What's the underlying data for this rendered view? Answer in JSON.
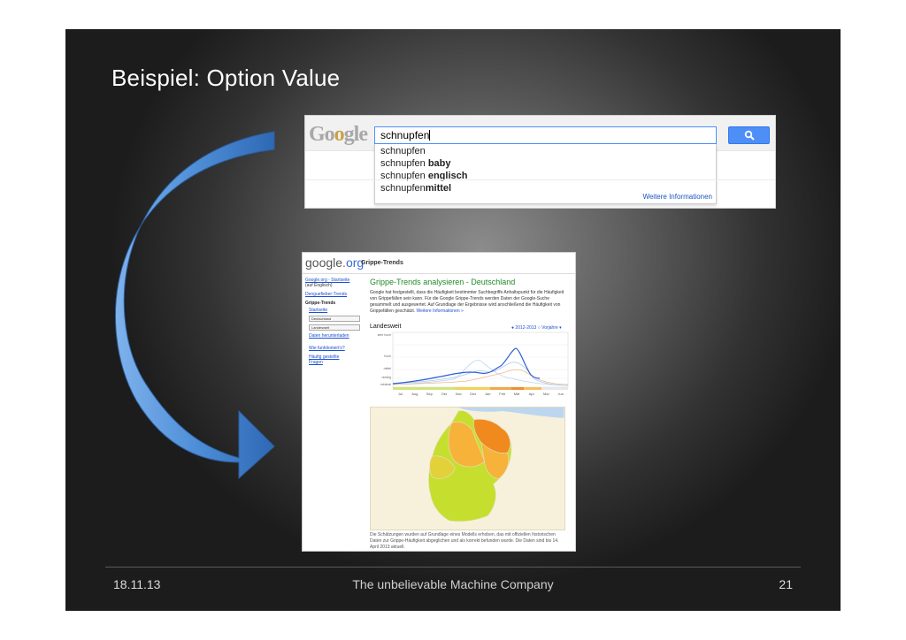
{
  "slide": {
    "title": "Beispiel: Option Value",
    "footer": {
      "date": "18.11.13",
      "company": "The unbelievable Machine Company",
      "page": "21"
    }
  },
  "search_screenshot": {
    "logo_text": "Google",
    "query": "schnupfen",
    "suggestions": [
      {
        "prefix": "schnupfen",
        "suffix": ""
      },
      {
        "prefix": "schnupfen ",
        "suffix": "baby"
      },
      {
        "prefix": "schnupfen ",
        "suffix": "englisch"
      },
      {
        "prefix": "schnupfen",
        "suffix": "mittel"
      }
    ],
    "more_info": "Weitere Informationen",
    "button_icon": "search-icon",
    "colors": {
      "button": "#4d8ef7",
      "border": "#4d90fe"
    }
  },
  "trends_screenshot": {
    "logo": {
      "google": "google",
      "dot": ".",
      "org": "org"
    },
    "product": "Grippe-Trends",
    "sidebar": {
      "home_link": "Google.org - Startseite",
      "home_note": "(auf Englisch)",
      "dengue_link": "Denguefieber-Trends",
      "section": "Grippe-Trends",
      "start_link": "Startseite",
      "country_select": "Deutschland",
      "region_select": "Landesweit",
      "download_link": "Daten herunterladen",
      "how_link": "Wie funktioniert's?",
      "faq_link_1": "Häufig gestellte",
      "faq_link_2": "Fragen"
    },
    "heading": "Grippe-Trends analysieren - Deutschland",
    "description": "Google hat festgestellt, dass die Häufigkeit bestimmter Suchbegriffe Anhaltspunkt für die Häufigkeit von Grippefällen sein kann. Für die Google Grippe-Trends werden Daten der Google-Suche gesammelt und ausgewertet. Auf Grundlage der Ergebnisse wird anschließend die Häufigkeit von Grippefällen geschätzt.",
    "description_link": "Weitere Informationen »",
    "region_label": "Landesweit",
    "season_label": "2012-2013",
    "prior_label": "Vorjahre",
    "chart": {
      "levels": [
        "sehr hoch",
        "hoch",
        "mittel",
        "niedrig",
        "minimal"
      ],
      "months": [
        "Jul",
        "Aug",
        "Sep",
        "Okt",
        "Nov",
        "Dez",
        "Jan",
        "Feb",
        "Mär",
        "Apr",
        "Mai",
        "Jun"
      ]
    },
    "footnote": "Die Schätzungen wurden auf Grundlage eines Modells erhoben, das mit offiziellen historischen Daten zur Grippe-Häufigkeit abgeglichen und als korrekt befunden wurde. Die Daten sind bis 14. April 2013 aktuell.",
    "colors": {
      "heading": "#1f8a27",
      "current_line": "#2d5fd4",
      "map_high": "#f08a1e",
      "map_mid": "#f7b23a",
      "map_low": "#c6df2e"
    }
  },
  "arrow": {
    "color": "#4f8fd8"
  }
}
